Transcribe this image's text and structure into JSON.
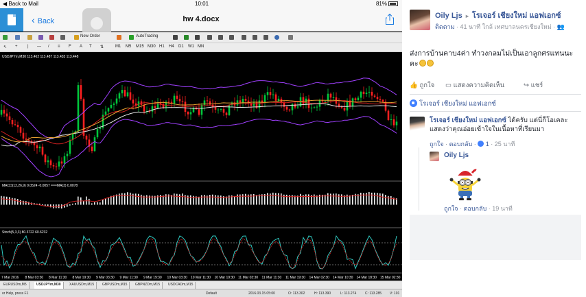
{
  "ipad": {
    "status": {
      "back_to_mail": "◀ Back to Mail",
      "time": "10:01",
      "battery": "81%"
    },
    "nav": {
      "back_label": "Back",
      "doc_title": "hw 4.docx"
    },
    "toolbar": {
      "new_order": "New Order",
      "auto_trading": "AutoTrading"
    },
    "timeframes": [
      "M1",
      "M5",
      "M15",
      "M30",
      "H1",
      "H4",
      "D1",
      "W1",
      "MN"
    ],
    "chart": {
      "main_label": "USDJPYm,M30  113.462 113.487 113.433 113.448",
      "macd_label": "MACD(12,26,9) 0.0524 -0.0057  ===MA(3) 0.0078",
      "stoch_label": "Stoch(5,3,3) 80.3722 60.6232",
      "time_ticks": [
        "7 Mar 2016",
        "8 Mar 03:30",
        "8 Mar 11:30",
        "8 Mar 19:30",
        "9 Mar 03:30",
        "9 Mar 11:30",
        "9 Mar 19:30",
        "10 Mar 03:30",
        "10 Mar 11:30",
        "10 Mar 19:30",
        "11 Mar 03:30",
        "11 Mar 11:30",
        "11 Mar 19:30",
        "14 Mar 02:30",
        "14 Mar 10:30",
        "14 Mar 18:30",
        "15 Mar 02:30"
      ]
    },
    "tabs": [
      "EURUSDm,M5",
      "USDJPYm,M30",
      "XAUUSDm,M15",
      "GBPUSDm,M15",
      "GBPNZDm,M15",
      "USDCADm,M15"
    ],
    "active_tab": 1,
    "statusline": {
      "help": "or Help, press F1",
      "profile": "Default",
      "datetime": "2016.03.15 05:00",
      "open": "O: 113.302",
      "high": "H: 113.390",
      "low": "L: 113.274",
      "close": "C: 113.285",
      "volume": "V: 101"
    }
  },
  "post": {
    "author": "Oily Ljs",
    "arrow": "▸",
    "group": "โรเจอร์ เชียงใหม่ แอฟเอกซ์",
    "follow": "ติดตาม",
    "meta_rest": " · 41 นาที ใกล้ เทศบาลนครเชียงใหม่ · ",
    "text": "ส่งการบ้านคาบ4ค่า ทำวงกลมไม่เป็นเอาลูกศรแทนนะคะ",
    "actions": {
      "like": "ถูกใจ",
      "comment": "แสดงความคิดเห็น",
      "share": "แชร์"
    },
    "reactors": "โรเจอร์ เชียงใหม่ แอฟเอกซ์"
  },
  "comment": {
    "name": "โรเจอร์ เชียงใหม่ แอฟเอกซ์",
    "text": " ได้ครับ แต่นี่ก็โอเคละ แสดงว่าคุณอ่อยเข้าใจในเนื้อหาที่เรียนมา",
    "like": "ถูกใจ",
    "reply": "ตอบกลับ",
    "likes": "1",
    "time": "25 นาที"
  },
  "reply": {
    "name": "Oily Ljs",
    "like": "ถูกใจ",
    "reply": "ตอบกลับ",
    "time": "19 นาที"
  },
  "colors": {
    "fb_blue": "#3b5998",
    "chart_up": "#00c83c",
    "chart_down": "#ff2020",
    "band": "#a040ff"
  }
}
